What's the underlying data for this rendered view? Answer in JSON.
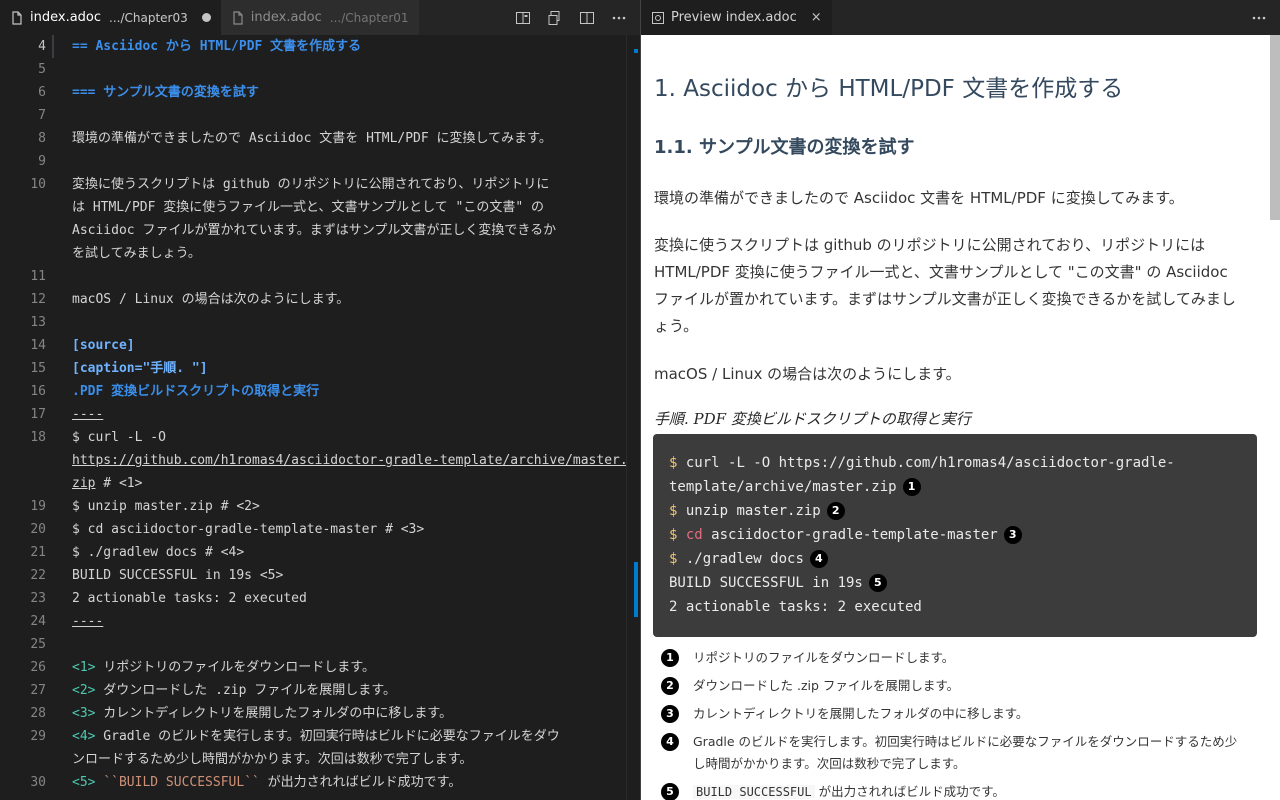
{
  "left_editor": {
    "tabs": [
      {
        "label": "index.adoc",
        "description": ".../Chapter03",
        "active": true,
        "dirty": true
      },
      {
        "label": "index.adoc",
        "description": ".../Chapter01",
        "active": false
      }
    ],
    "actions": [
      "open-preview-icon",
      "compare-icon",
      "split-editor-icon",
      "more-actions-icon"
    ],
    "lines": [
      {
        "n": "4",
        "segments": [
          {
            "t": "== Asciidoc から HTML/PDF 文書を作成する",
            "s": "heading"
          }
        ]
      },
      {
        "n": "5",
        "segments": []
      },
      {
        "n": "6",
        "segments": [
          {
            "t": "=== サンプル文書の変換を試す",
            "s": "heading"
          }
        ]
      },
      {
        "n": "7",
        "segments": []
      },
      {
        "n": "8",
        "segments": [
          {
            "t": "環境の準備ができましたので Asciidoc 文書を HTML/PDF に変換してみます。",
            "s": ""
          }
        ]
      },
      {
        "n": "9",
        "segments": []
      },
      {
        "n": "10",
        "segments": [
          {
            "t": "変換に使うスクリプトは github のリポジトリに公開されており、リポジトリに",
            "s": ""
          }
        ]
      },
      {
        "n": "",
        "segments": [
          {
            "t": "は HTML/PDF 変換に使うファイル一式と、文書サンプルとして \"この文書\" の",
            "s": ""
          }
        ]
      },
      {
        "n": "",
        "segments": [
          {
            "t": "Asciidoc ファイルが置かれています。まずはサンプル文書が正しく変換できるか",
            "s": ""
          }
        ]
      },
      {
        "n": "",
        "segments": [
          {
            "t": "を試してみましょう。",
            "s": ""
          }
        ]
      },
      {
        "n": "11",
        "segments": []
      },
      {
        "n": "12",
        "segments": [
          {
            "t": "macOS / Linux の場合は次のようにします。",
            "s": ""
          }
        ]
      },
      {
        "n": "13",
        "segments": []
      },
      {
        "n": "14",
        "segments": [
          {
            "t": "[source]",
            "s": "attr"
          }
        ]
      },
      {
        "n": "15",
        "segments": [
          {
            "t": "[caption=\"手順. \"]",
            "s": "attr"
          }
        ]
      },
      {
        "n": "16",
        "segments": [
          {
            "t": ".PDF 変換ビルドスクリプトの取得と実行",
            "s": "heading"
          }
        ]
      },
      {
        "n": "17",
        "segments": [
          {
            "t": "----",
            "s": "link"
          }
        ]
      },
      {
        "n": "18",
        "segments": [
          {
            "t": "$ curl -L -O",
            "s": ""
          }
        ]
      },
      {
        "n": "",
        "segments": [
          {
            "t": "https://github.com/h1romas4/asciidoctor-gradle-template/archive/master.",
            "s": "link"
          }
        ]
      },
      {
        "n": "",
        "segments": [
          {
            "t": "zip",
            "s": "link"
          },
          {
            "t": " # <1>",
            "s": ""
          }
        ]
      },
      {
        "n": "19",
        "segments": [
          {
            "t": "$ unzip master.zip # <2>",
            "s": ""
          }
        ]
      },
      {
        "n": "20",
        "segments": [
          {
            "t": "$ cd asciidoctor-gradle-template-master # <3>",
            "s": ""
          }
        ]
      },
      {
        "n": "21",
        "segments": [
          {
            "t": "$ ./gradlew docs # <4>",
            "s": ""
          }
        ]
      },
      {
        "n": "22",
        "segments": [
          {
            "t": "BUILD SUCCESSFUL in 19s <5>",
            "s": ""
          }
        ]
      },
      {
        "n": "23",
        "segments": [
          {
            "t": "2 actionable tasks: 2 executed",
            "s": ""
          }
        ]
      },
      {
        "n": "24",
        "segments": [
          {
            "t": "----",
            "s": "link"
          }
        ]
      },
      {
        "n": "25",
        "segments": []
      },
      {
        "n": "26",
        "segments": [
          {
            "t": "<1>",
            "s": "callout"
          },
          {
            "t": " リポジトリのファイルをダウンロードします。",
            "s": ""
          }
        ]
      },
      {
        "n": "27",
        "segments": [
          {
            "t": "<2>",
            "s": "callout"
          },
          {
            "t": " ダウンロードした .zip ファイルを展開します。",
            "s": ""
          }
        ]
      },
      {
        "n": "28",
        "segments": [
          {
            "t": "<3>",
            "s": "callout"
          },
          {
            "t": " カレントディレクトリを展開したフォルダの中に移します。",
            "s": ""
          }
        ]
      },
      {
        "n": "29",
        "segments": [
          {
            "t": "<4>",
            "s": "callout"
          },
          {
            "t": " Gradle のビルドを実行します。初回実行時はビルドに必要なファイルをダウ",
            "s": ""
          }
        ]
      },
      {
        "n": "",
        "segments": [
          {
            "t": "ンロードするため少し時間がかかります。次回は数秒で完了します。",
            "s": ""
          }
        ]
      },
      {
        "n": "30",
        "segments": [
          {
            "t": "<5>",
            "s": "callout"
          },
          {
            "t": " ",
            "s": ""
          },
          {
            "t": "``BUILD SUCCESSFUL``",
            "s": "mono"
          },
          {
            "t": " が出力されればビルド成功です。",
            "s": ""
          }
        ]
      }
    ]
  },
  "preview": {
    "tab": {
      "label": "Preview index.adoc",
      "close": "×"
    },
    "actions": [
      "more-actions-icon"
    ],
    "h1": "1. Asciidoc から HTML/PDF 文書を作成する",
    "h2": "1.1. サンプル文書の変換を試す",
    "p1": "環境の準備ができましたので Asciidoc 文書を HTML/PDF に変換してみます。",
    "p2_lines": [
      "変換に使うスクリプトは github のリポジトリに公開されており、リポジトリには",
      "HTML/PDF 変換に使うファイル一式と、文書サンプルとして \"この文書\" の Asciidoc",
      "ファイルが置かれています。まずはサンプル文書が正しく変換できるかを試してみまし",
      "ょう。"
    ],
    "p3": "macOS / Linux の場合は次のようにします。",
    "listing_title": "手順. PDF 変換ビルドスクリプトの取得と実行",
    "code_lines": [
      {
        "prompt": "$",
        "cmd": "",
        "text": " curl -L -O https://github.com/h1romas4/asciidoctor-gradle-",
        "conum": ""
      },
      {
        "prompt": "",
        "cmd": "",
        "text": "template/archive/master.zip",
        "conum": "1"
      },
      {
        "prompt": "$",
        "cmd": "",
        "text": " unzip master.zip",
        "conum": "2"
      },
      {
        "prompt": "$",
        "cmd": " cd",
        "text": " asciidoctor-gradle-template-master",
        "conum": "3"
      },
      {
        "prompt": "$",
        "cmd": "",
        "text": " ./gradlew docs",
        "conum": "4"
      },
      {
        "prompt": "",
        "cmd": "",
        "text": "BUILD SUCCESSFUL in 19s",
        "conum": "5"
      },
      {
        "prompt": "",
        "cmd": "",
        "text": "2 actionable tasks: 2 executed",
        "conum": ""
      }
    ],
    "callouts": [
      {
        "num": "1",
        "lines": [
          "リポジトリのファイルをダウンロードします。"
        ]
      },
      {
        "num": "2",
        "lines": [
          "ダウンロードした .zip ファイルを展開します。"
        ]
      },
      {
        "num": "3",
        "lines": [
          "カレントディレクトリを展開したフォルダの中に移します。"
        ]
      },
      {
        "num": "4",
        "lines": [
          "Gradle のビルドを実行します。初回実行時はビルドに必要なファイルをダウンロードするため少",
          "し時間がかかります。次回は数秒で完了します。"
        ]
      },
      {
        "num": "5",
        "code": "BUILD SUCCESSFUL",
        "lines": [
          " が出力されればビルド成功です。"
        ]
      }
    ]
  },
  "colors": {
    "editor_bg": "#1e1e1e",
    "tabbar_bg": "#252526",
    "heading": "#3b8eea",
    "callout": "#4ec9b0",
    "preview_heading": "#34495e",
    "code_block_bg": "#3c3c3c"
  }
}
